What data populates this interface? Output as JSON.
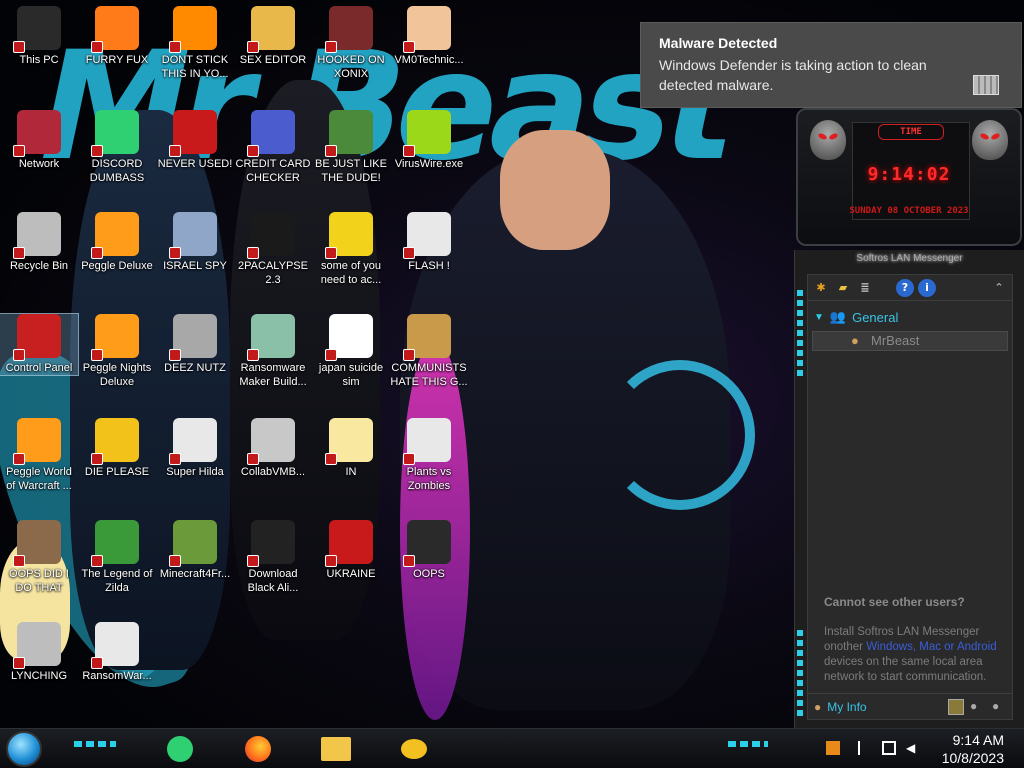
{
  "desktop_icons": [
    {
      "label": "This PC",
      "icon": "computer-icon",
      "color": "#2a2a2a"
    },
    {
      "label": "FURRY FUX",
      "icon": "firefox-icon",
      "color": "#ff7b1a"
    },
    {
      "label": "DONT STICK THIS IN YO...",
      "icon": "vlc-cone-icon",
      "color": "#ff8a00"
    },
    {
      "label": "SEX EDITOR",
      "icon": "hex-editor-icon",
      "color": "#e8b84a"
    },
    {
      "label": "HOOKED ON XONIX",
      "icon": "xonix-game-icon",
      "color": "#7a2a2a"
    },
    {
      "label": "VM0Technic...",
      "icon": "doctor-icon",
      "color": "#f2c49a"
    },
    {
      "label": "Network",
      "icon": "network-icon",
      "color": "#b0283a"
    },
    {
      "label": "DISCORD DUMBASS",
      "icon": "discord-icon",
      "color": "#2fd072"
    },
    {
      "label": "NEVER USED!",
      "icon": "dev-cpp-icon",
      "color": "#c8191b"
    },
    {
      "label": "CREDIT CARD CHECKER",
      "icon": "credit-card-icon",
      "color": "#4b5ccf"
    },
    {
      "label": "BE JUST LIKE THE DUDE!",
      "icon": "santa-icon",
      "color": "#4a8a3a"
    },
    {
      "label": "VirusWire.exe",
      "icon": "lime-icon",
      "color": "#9cd81a"
    },
    {
      "label": "Recycle Bin",
      "icon": "recycle-bin-icon",
      "color": "#bdbdbd"
    },
    {
      "label": "Peggle Deluxe",
      "icon": "peggle-icon",
      "color": "#ff9c1a"
    },
    {
      "label": "ISRAEL SPY",
      "icon": "spy-keyboard-icon",
      "color": "#8fa6c8"
    },
    {
      "label": "2PACALYPSE 2.3",
      "icon": "terminal-icon",
      "color": "#1a1a1a"
    },
    {
      "label": "some of you need to ac...",
      "icon": "beaver-icon",
      "color": "#f2d21a"
    },
    {
      "label": "FLASH !",
      "icon": "flash-file-icon",
      "color": "#e8e8e8"
    },
    {
      "label": "Control Panel",
      "icon": "control-panel-icon",
      "color": "#c82020"
    },
    {
      "label": "Peggle Nights Deluxe",
      "icon": "peggle-nights-icon",
      "color": "#ff9c1a"
    },
    {
      "label": "DEEZ NUTZ",
      "icon": "windows-stack-icon",
      "color": "#a8a8a8"
    },
    {
      "label": "Ransomware Maker Build...",
      "icon": "installer-icon",
      "color": "#8ac0a8"
    },
    {
      "label": "japan suicide sim",
      "icon": "document-icon",
      "color": "#ffffff"
    },
    {
      "label": "COMMUNISTS HATE THIS G...",
      "icon": "money-bag-icon",
      "color": "#c89a4a"
    },
    {
      "label": "Peggle World of Warcraft ...",
      "icon": "peggle-wow-icon",
      "color": "#ff9c1a"
    },
    {
      "label": "DIE PLEASE",
      "icon": "delphi-ide-icon",
      "color": "#f2c21a"
    },
    {
      "label": "Super Hilda",
      "icon": "pixel-art-icon",
      "color": "#e8e8e8"
    },
    {
      "label": "CollabVMB...",
      "icon": "monitor-icon",
      "color": "#c8c8c8"
    },
    {
      "label": "IN",
      "icon": "star-butterfly-icon",
      "color": "#f8e8a0"
    },
    {
      "label": "Plants vs Zombies",
      "icon": "plants-vs-zombies-icon",
      "color": "#e8e8e8"
    },
    {
      "label": "OOPS DID I DO THAT",
      "icon": "portrait-icon",
      "color": "#8a6a4a"
    },
    {
      "label": "The Legend of Zilda",
      "icon": "zelda-icon",
      "color": "#3a9a3a"
    },
    {
      "label": "Minecraft4Fr...",
      "icon": "grass-block-icon",
      "color": "#6a9a3a"
    },
    {
      "label": "Download Black Ali...",
      "icon": "alien-icon",
      "color": "#222222"
    },
    {
      "label": "UKRAINE",
      "icon": "radiation-icon",
      "color": "#c81a1a"
    },
    {
      "label": "OOPS",
      "icon": "book-icon",
      "color": "#2a2a2a"
    },
    {
      "label": "LYNCHING",
      "icon": "noose-icon",
      "color": "#bdbdbd"
    },
    {
      "label": "RansomWar...",
      "icon": "skull-icon",
      "color": "#e8e8e8"
    }
  ],
  "toast": {
    "title": "Malware Detected",
    "body": "Windows Defender is taking action to clean detected malware."
  },
  "clock_gadget": {
    "label": "TIME",
    "time": "9:14:02",
    "date": "SUNDAY 08 OCTOBER 2023"
  },
  "messenger": {
    "title": "Softros LAN Messenger",
    "group": "General",
    "user": "MrBeast",
    "help_title": "Cannot see other users?",
    "help_pre": "Install Softros LAN Messenger onother ",
    "help_link": "Windows, Mac or Android",
    "help_post": " devices on the same local area network to start communication.",
    "my_info": "My Info"
  },
  "taskbar": {
    "time": "9:14 AM",
    "date": "10/8/2023"
  },
  "colors": {
    "accent_cyan": "#2bd0e8",
    "toast_bg": "#4a4a4a",
    "gadget_red": "#ff2a2a"
  }
}
